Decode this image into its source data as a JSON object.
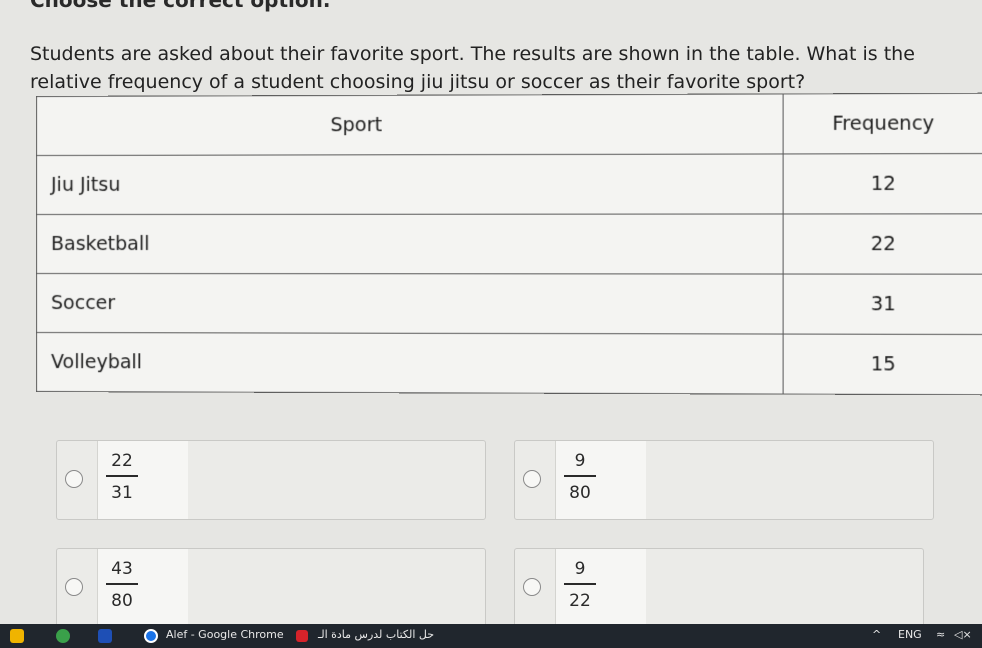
{
  "header_cut": "Choose the correct option.",
  "question": "Students are asked about their favorite sport. The results are shown in the table. What is the relative frequency of a student choosing jiu jitsu or soccer as their favorite sport?",
  "table": {
    "headers": [
      "Sport",
      "Frequency"
    ],
    "rows": [
      {
        "sport": "Jiu Jitsu",
        "frequency": "12"
      },
      {
        "sport": "Basketball",
        "frequency": "22"
      },
      {
        "sport": "Soccer",
        "frequency": "31"
      },
      {
        "sport": "Volleyball",
        "frequency": "15"
      }
    ]
  },
  "options": [
    {
      "numerator": "22",
      "denominator": "31"
    },
    {
      "numerator": "9",
      "denominator": "80"
    },
    {
      "numerator": "43",
      "denominator": "80"
    },
    {
      "numerator": "9",
      "denominator": "22"
    }
  ],
  "taskbar": {
    "chrome_label": "Alef - Google Chrome",
    "arabic_label": "حل الكتاب لدرس مادة الـ",
    "language": "ENG",
    "arrow": "^"
  },
  "colors": {
    "taskbar_bg": "#20262d",
    "chrome_blue": "#1a73e8",
    "p_icon_red": "#d6232a"
  }
}
